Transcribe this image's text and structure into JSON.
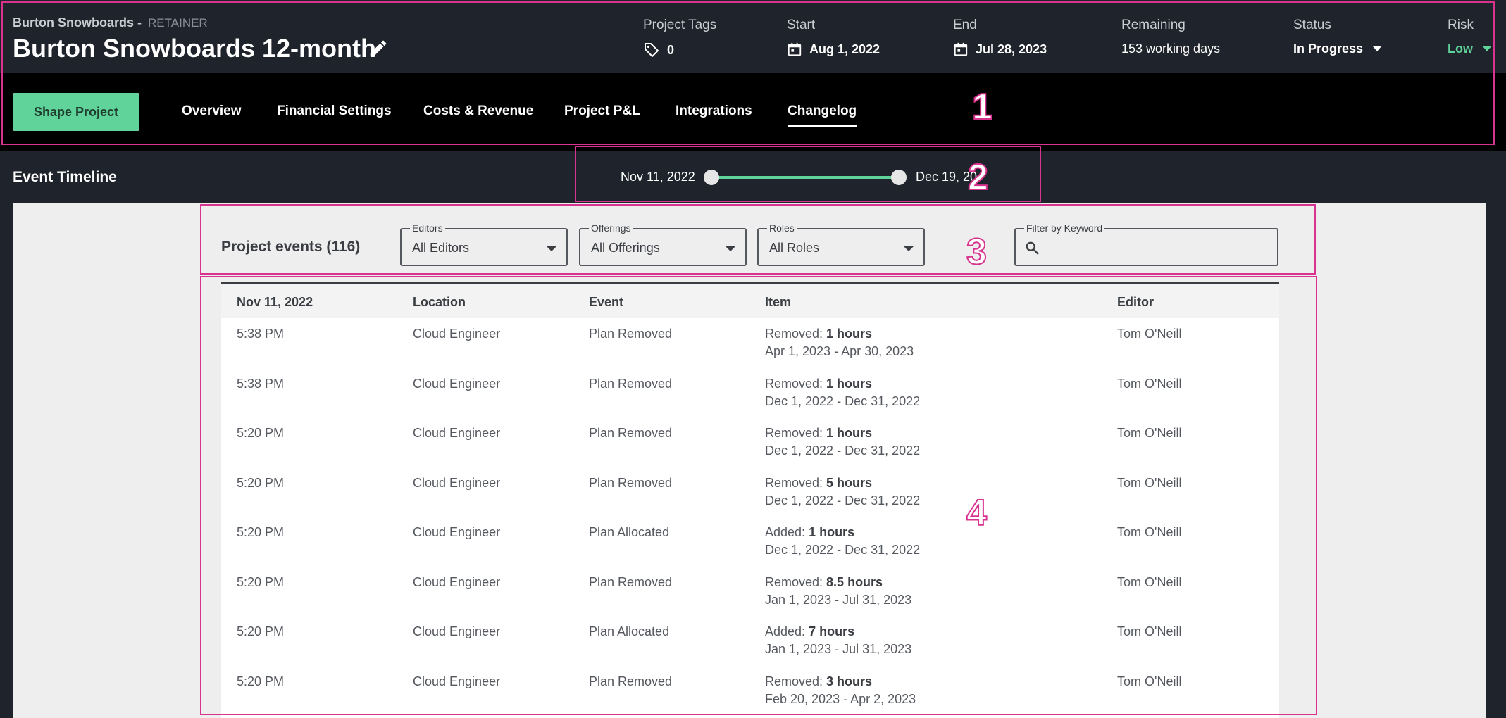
{
  "header": {
    "client": "Burton Snowboards -",
    "project_type": "RETAINER",
    "title": "Burton Snowboards 12-month",
    "project_tags_label": "Project Tags",
    "project_tags_value": "0",
    "start_label": "Start",
    "start_value": "Aug 1, 2022",
    "end_label": "End",
    "end_value": "Jul 28, 2023",
    "remaining_label": "Remaining",
    "remaining_value": "153 working days",
    "status_label": "Status",
    "status_value": "In Progress",
    "risk_label": "Risk",
    "risk_value": "Low"
  },
  "nav": {
    "shape_button": "Shape Project",
    "tabs": [
      "Overview",
      "Financial Settings",
      "Costs & Revenue",
      "Project P&L",
      "Integrations",
      "Changelog"
    ],
    "active_tab": "Changelog"
  },
  "timeline": {
    "title": "Event Timeline",
    "range_start": "Nov 11, 2022",
    "range_end": "Dec 19, 20"
  },
  "filters": {
    "title": "Project events (116)",
    "editors_label": "Editors",
    "editors_value": "All Editors",
    "offerings_label": "Offerings",
    "offerings_value": "All Offerings",
    "roles_label": "Roles",
    "roles_value": "All Roles",
    "keyword_label": "Filter by Keyword",
    "keyword_value": ""
  },
  "table": {
    "columns": [
      "Nov 11, 2022",
      "Location",
      "Event",
      "Item",
      "Editor"
    ],
    "rows": [
      {
        "time": "5:38 PM",
        "location": "Cloud Engineer",
        "event": "Plan Removed",
        "item_prefix": "Removed: ",
        "item_amount": "1 hours",
        "item_range": "Apr 1, 2023 - Apr 30, 2023",
        "editor": "Tom O'Neill"
      },
      {
        "time": "5:38 PM",
        "location": "Cloud Engineer",
        "event": "Plan Removed",
        "item_prefix": "Removed: ",
        "item_amount": "1 hours",
        "item_range": "Dec 1, 2022 - Dec 31, 2022",
        "editor": "Tom O'Neill"
      },
      {
        "time": "5:20 PM",
        "location": "Cloud Engineer",
        "event": "Plan Removed",
        "item_prefix": "Removed: ",
        "item_amount": "1 hours",
        "item_range": "Dec 1, 2022 - Dec 31, 2022",
        "editor": "Tom O'Neill"
      },
      {
        "time": "5:20 PM",
        "location": "Cloud Engineer",
        "event": "Plan Removed",
        "item_prefix": "Removed: ",
        "item_amount": "5 hours",
        "item_range": "Dec 1, 2022 - Dec 31, 2022",
        "editor": "Tom O'Neill"
      },
      {
        "time": "5:20 PM",
        "location": "Cloud Engineer",
        "event": "Plan Allocated",
        "item_prefix": "Added: ",
        "item_amount": "1 hours",
        "item_range": "Dec 1, 2022 - Dec 31, 2022",
        "editor": "Tom O'Neill"
      },
      {
        "time": "5:20 PM",
        "location": "Cloud Engineer",
        "event": "Plan Removed",
        "item_prefix": "Removed: ",
        "item_amount": "8.5 hours",
        "item_range": "Jan 1, 2023 - Jul 31, 2023",
        "editor": "Tom O'Neill"
      },
      {
        "time": "5:20 PM",
        "location": "Cloud Engineer",
        "event": "Plan Allocated",
        "item_prefix": "Added: ",
        "item_amount": "7 hours",
        "item_range": "Jan 1, 2023 - Jul 31, 2023",
        "editor": "Tom O'Neill"
      },
      {
        "time": "5:20 PM",
        "location": "Cloud Engineer",
        "event": "Plan Removed",
        "item_prefix": "Removed: ",
        "item_amount": "3 hours",
        "item_range": "Feb 20, 2023 - Apr 2, 2023",
        "editor": "Tom O'Neill"
      }
    ]
  },
  "annotations": [
    "1",
    "2",
    "3",
    "4"
  ],
  "colors": {
    "accent_green": "#5fd39a",
    "annotation_pink": "#d8338e",
    "header_bg": "#1f232b",
    "nav_bg": "#000000"
  }
}
